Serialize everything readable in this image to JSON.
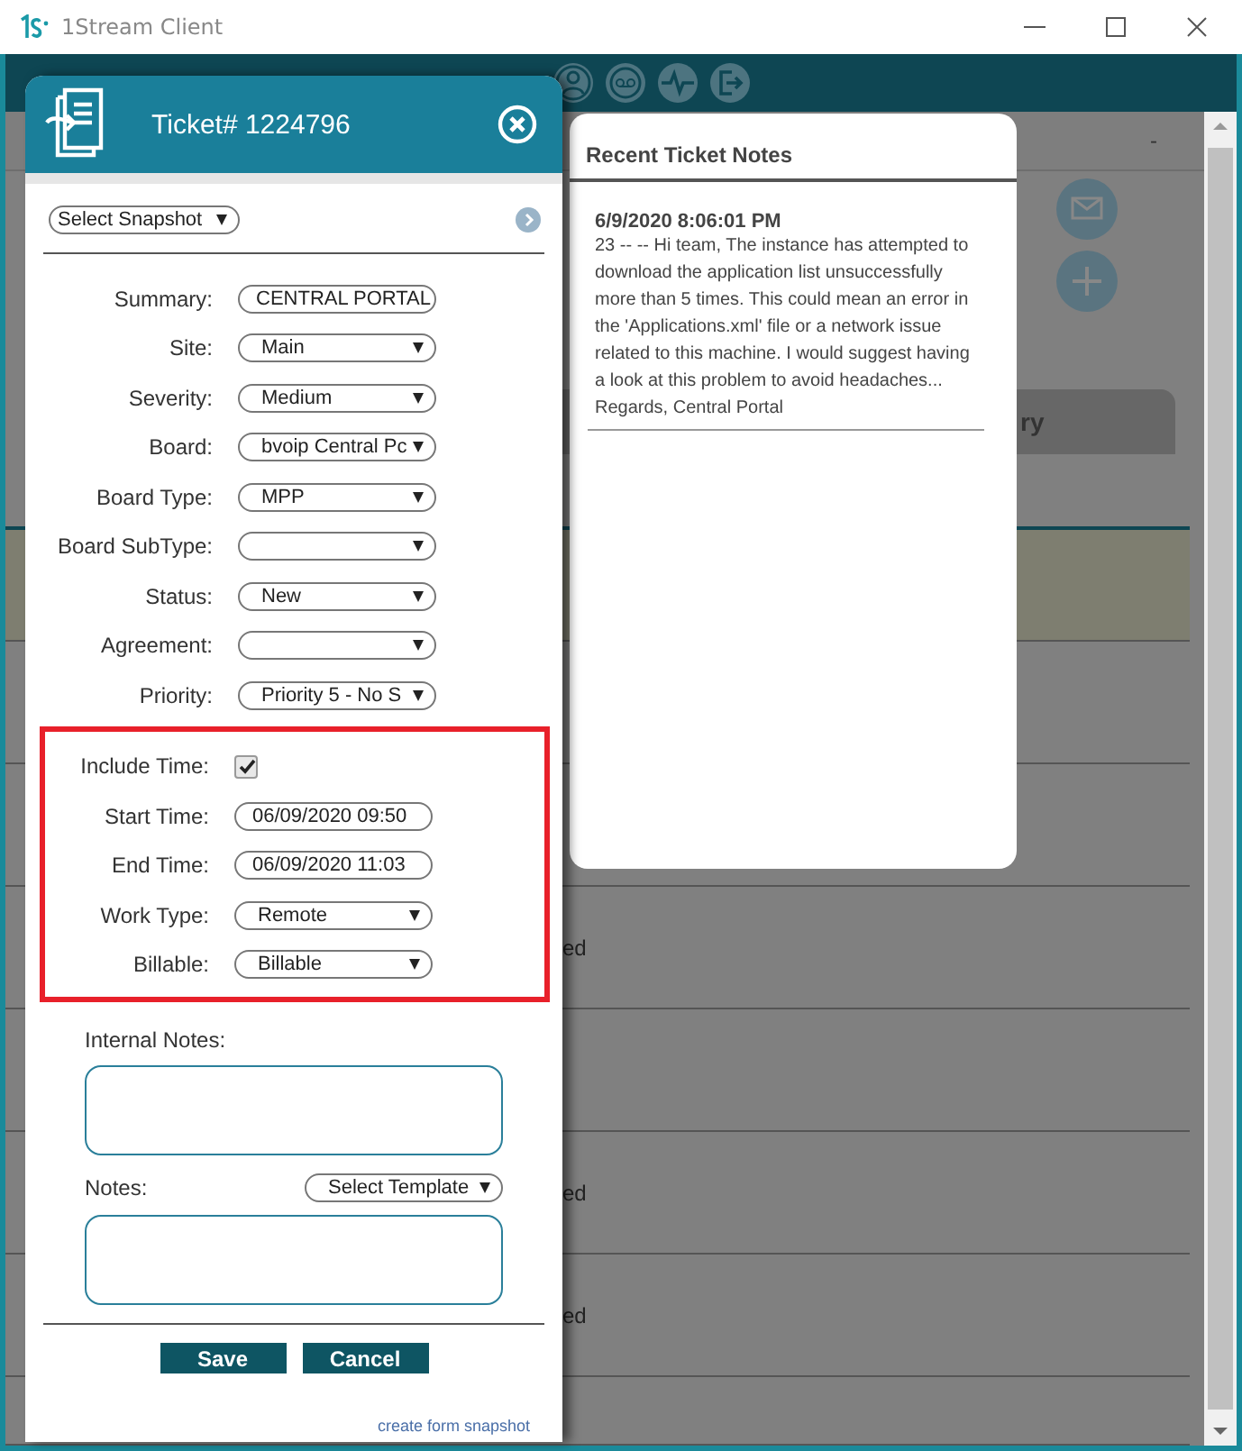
{
  "window": {
    "title": "1Stream Client"
  },
  "background": {
    "header_text": "-",
    "tab_label": "ry",
    "rows": [
      {
        "highlighted": true
      },
      {
        "highlighted": false
      },
      {
        "highlighted": false
      },
      {
        "highlighted": false,
        "text": "ed"
      },
      {
        "highlighted": false
      },
      {
        "highlighted": false,
        "text": "ed"
      },
      {
        "highlighted": false,
        "text": "ed"
      },
      {
        "highlighted": false
      }
    ]
  },
  "ticket": {
    "title": "Ticket# 1224796",
    "snapshot": "Select Snapshot",
    "fields": [
      {
        "kind": "text",
        "label": "Summary:",
        "value": "CENTRAL PORTAL"
      },
      {
        "kind": "select",
        "label": "Site:",
        "value": "Main"
      },
      {
        "kind": "select",
        "label": "Severity:",
        "value": "Medium"
      },
      {
        "kind": "select",
        "label": "Board:",
        "value": "bvoip Central Pc"
      },
      {
        "kind": "select",
        "label": "Board Type:",
        "value": "MPP"
      },
      {
        "kind": "select",
        "label": "Board SubType:"
      },
      {
        "kind": "select",
        "label": "Status:",
        "value": "New"
      },
      {
        "kind": "select",
        "label": "Agreement:"
      },
      {
        "kind": "select",
        "label": "Priority:",
        "value": "Priority 5 - No S"
      }
    ],
    "time_fields": [
      {
        "kind": "checkbox",
        "label": "Include Time:",
        "checked": true
      },
      {
        "kind": "text",
        "label": "Start Time:",
        "value": "06/09/2020 09:50"
      },
      {
        "kind": "text",
        "label": "End Time:",
        "value": "06/09/2020 11:03"
      },
      {
        "kind": "select",
        "label": "Work Type:",
        "value": "Remote"
      },
      {
        "kind": "select",
        "label": "Billable:",
        "value": "Billable"
      }
    ],
    "internal_notes_label": "Internal Notes:",
    "notes_label": "Notes:",
    "template": "Select Template",
    "buttons": [
      "Save",
      "Cancel"
    ],
    "snapshot_link": "create form snapshot"
  },
  "recent_notes": {
    "title": "Recent Ticket Notes",
    "notes": [
      {
        "date": "6/9/2020 8:06:01 PM",
        "text": "23 -- -- Hi team, The instance has attempted to download the application list unsuccessfully more than 5 times. This could mean an error in the 'Applications.xml' file or a network issue related to this machine. I would suggest having a look at this problem to avoid headaches... Regards, Central Portal"
      }
    ]
  }
}
